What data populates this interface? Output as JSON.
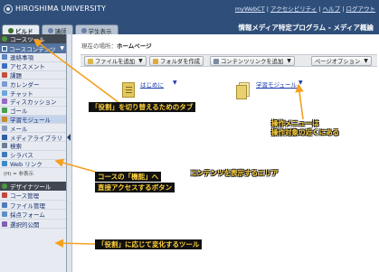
{
  "header": {
    "university": "HIROSHIMA UNIVERSITY",
    "links": [
      "myWebCT",
      "アクセシビリティ",
      "ヘルプ",
      "ログアウト"
    ],
    "separators": " | ",
    "course_title": "情報メディア特定プログラム - メディア概論"
  },
  "tabs": [
    {
      "label": "ビルド",
      "active": true
    },
    {
      "label": "講師",
      "active": false
    },
    {
      "label": "学生表示",
      "active": false
    }
  ],
  "sidebar": {
    "course_tools_header": "コースツール",
    "course_content_label": "コースコンテンツ",
    "course_content_dropdown": "▼",
    "items": [
      {
        "label": "連絡事項",
        "color": "#5b86c6"
      },
      {
        "label": "アセスメント",
        "color": "#3a6fc1"
      },
      {
        "label": "課題",
        "color": "#c34f3c"
      },
      {
        "label": "カレンダー",
        "color": "#7c9ad4"
      },
      {
        "label": "チャット",
        "color": "#6ca7d9"
      },
      {
        "label": "ディスカッション",
        "color": "#9a6ac4"
      },
      {
        "label": "ゴール",
        "color": "#4aa04f"
      },
      {
        "label": "学習モジュール",
        "color": "#cc8a2c"
      },
      {
        "label": "メール",
        "color": "#8a9fc0"
      },
      {
        "label": "メディアライブラリ",
        "color": "#2f5da8"
      },
      {
        "label": "検索",
        "color": "#6f7d94"
      },
      {
        "label": "シラバス",
        "color": "#3c7ab8"
      },
      {
        "label": "Web リンク",
        "color": "#3c8cc6"
      }
    ],
    "note": "(H) = 非表示",
    "designer_tools_header": "デザイナツール",
    "tools": [
      {
        "label": "コース管理",
        "color": "#c3473b"
      },
      {
        "label": "ファイル管理",
        "color": "#4f7bbd"
      },
      {
        "label": "採点フォーム",
        "color": "#5f8fc9"
      },
      {
        "label": "選択的公開",
        "color": "#7e5fb0"
      }
    ]
  },
  "main": {
    "breadcrumb_prefix": "現在の場所：",
    "breadcrumb_current": "ホームページ",
    "toolbar": {
      "add_file": "ファイルを追加",
      "create_folder": "フォルダを作成",
      "add_content_link": "コンテンツリンクを追加",
      "page_options": "ページオプション"
    },
    "content_items": [
      {
        "label": "はじめに",
        "icon": "document-icon"
      },
      {
        "label": "学習モジュール",
        "icon": "learning-module-icon"
      }
    ]
  },
  "annotations": {
    "role_tabs": "「役割」を切り替えるためのタブ",
    "action_menu_line1": "操作メニューは",
    "action_menu_line2": "操作対象の近くにある",
    "content_area": "コンテンツを表示するエリア",
    "tools_line1": "コースの「機能」へ",
    "tools_line2": "直接アクセスするボタン",
    "designer_tools": "「役割」に応じて変化するツール"
  },
  "colors": {
    "header_bg": "#2f4f7a",
    "annotation_text": "#ffd23a",
    "arrow": "#f4a020",
    "link": "#1b3aa8"
  }
}
